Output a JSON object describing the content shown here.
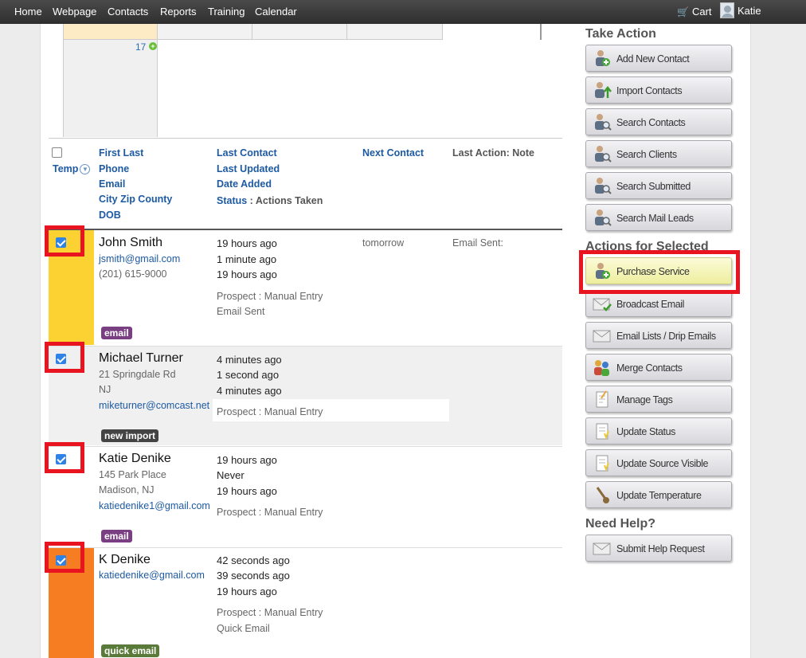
{
  "nav": {
    "items": [
      "Home",
      "Webpage",
      "Contacts",
      "Reports",
      "Training",
      "Calendar"
    ],
    "cart": "Cart",
    "user": "Katie"
  },
  "calendar": {
    "day_number": "17"
  },
  "table_header": {
    "col1": [
      "First Last",
      "Phone",
      "Email",
      "City Zip County",
      "DOB"
    ],
    "temp": "Temp",
    "col2": [
      "Last Contact",
      "Last Updated",
      "Date Added"
    ],
    "status_label": "Status",
    "status_suffix": " : Actions Taken",
    "next_contact": "Next Contact",
    "last_action": "Last Action: Note"
  },
  "rows": [
    {
      "name": "John Smith",
      "line1": "jsmith@gmail.com",
      "line2": "(201) 615-9000",
      "line3": "",
      "last_contact": "19 hours ago",
      "last_updated": "1 minute ago",
      "date_added": "19 hours ago",
      "status": "Prospect : Manual Entry",
      "action": "Email Sent",
      "next_contact": "tomorrow",
      "last_action": "Email Sent:",
      "tag": "email",
      "tag_color": "#7a3f82",
      "temp_color": "#fcd232",
      "checked": true
    },
    {
      "name": "Michael Turner",
      "line1": "21 Springdale Rd",
      "line2": "NJ",
      "line3": "miketurner@comcast.net",
      "last_contact": "4 minutes ago",
      "last_updated": "1 second ago",
      "date_added": "4 minutes ago",
      "status": "Prospect : Manual Entry",
      "action": "",
      "next_contact": "",
      "last_action": "",
      "tag": "new import",
      "tag_color": "#444444",
      "temp_color": "#f0f0f0",
      "checked": true
    },
    {
      "name": "Katie Denike",
      "line1": "145 Park Place",
      "line2": "Madison, NJ",
      "line3": "katiedenike1@gmail.com",
      "last_contact": "19 hours ago",
      "last_updated": "Never",
      "date_added": "19 hours ago",
      "status": "Prospect : Manual Entry",
      "action": "",
      "next_contact": "",
      "last_action": "",
      "tag": "email",
      "tag_color": "#7a3f82",
      "temp_color": "#ffffff",
      "checked": true
    },
    {
      "name": "K Denike",
      "line1": "katiedenike@gmail.com",
      "line2": "",
      "line3": "",
      "last_contact": "42 seconds ago",
      "last_updated": "39 seconds ago",
      "date_added": "19 hours ago",
      "status": "Prospect : Manual Entry",
      "action": "Quick Email",
      "next_contact": "",
      "last_action": "",
      "tag": "quick email",
      "tag_color": "#5a7a3a",
      "temp_color": "#f77d22",
      "checked": true
    }
  ],
  "sidebar": {
    "take_action_title": "Take Action",
    "take_action": [
      {
        "label": "Add New Contact",
        "icon": "add-contact-icon"
      },
      {
        "label": "Import Contacts",
        "icon": "import-contacts-icon"
      },
      {
        "label": "Search Contacts",
        "icon": "search-contacts-icon"
      },
      {
        "label": "Search Clients",
        "icon": "search-clients-icon"
      },
      {
        "label": "Search Submitted",
        "icon": "search-submitted-icon"
      },
      {
        "label": "Search Mail Leads",
        "icon": "search-mail-leads-icon"
      }
    ],
    "selected_title": "Actions for Selected",
    "selected": [
      {
        "label": "Purchase Service",
        "icon": "purchase-service-icon"
      },
      {
        "label": "Broadcast Email",
        "icon": "broadcast-email-icon"
      },
      {
        "label": "Email Lists / Drip Emails",
        "icon": "email-lists-icon"
      },
      {
        "label": "Merge Contacts",
        "icon": "merge-contacts-icon"
      },
      {
        "label": "Manage Tags",
        "icon": "manage-tags-icon"
      },
      {
        "label": "Update Status",
        "icon": "update-status-icon"
      },
      {
        "label": "Update Source Visible",
        "icon": "update-source-icon"
      },
      {
        "label": "Update Temperature",
        "icon": "thermometer-icon"
      }
    ],
    "help_title": "Need Help?",
    "help": [
      {
        "label": "Submit Help Request",
        "icon": "help-request-icon"
      }
    ]
  }
}
